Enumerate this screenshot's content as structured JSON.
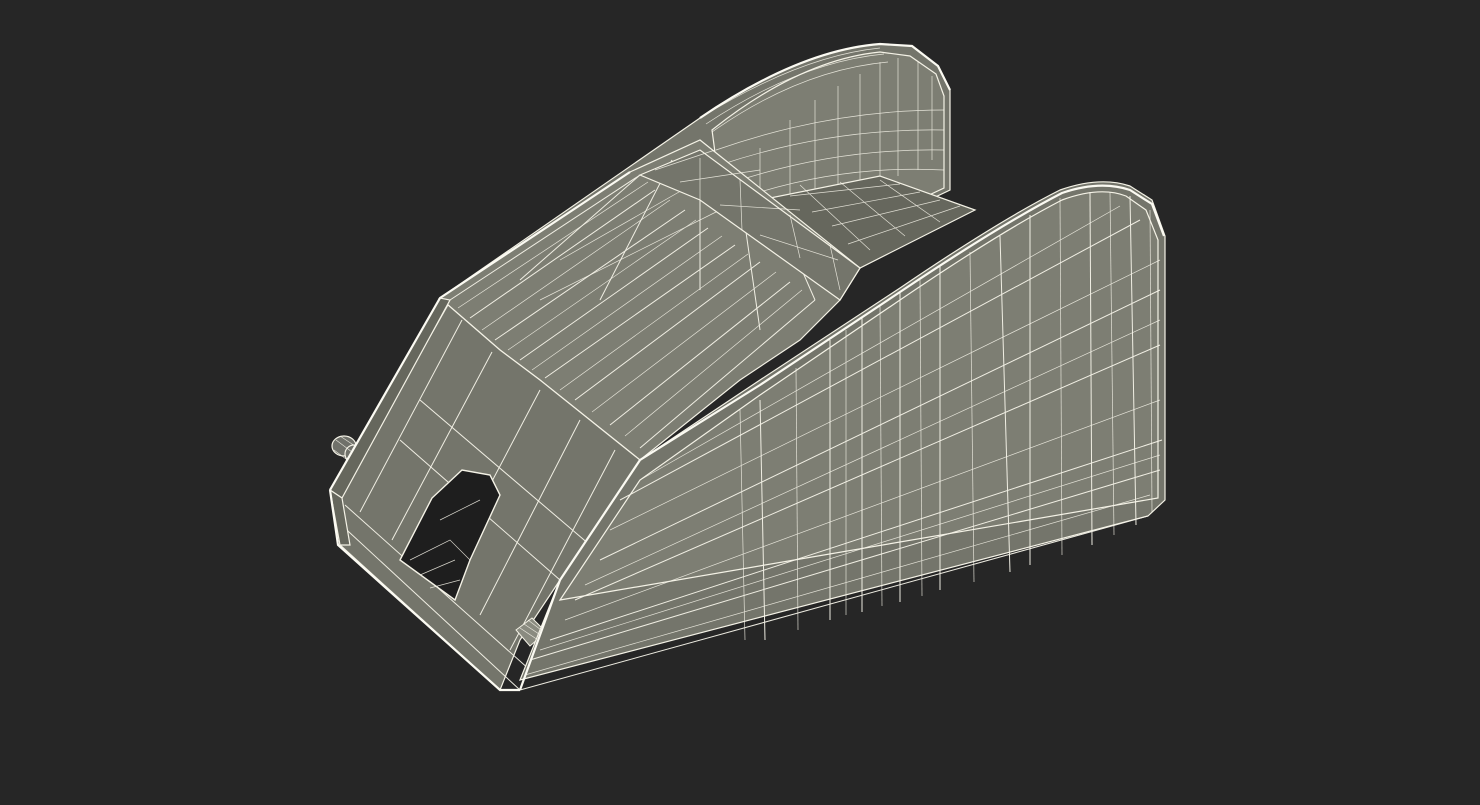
{
  "scene": {
    "background_color": "#262626",
    "model_fill_color": "#7a7b70",
    "wireframe_color": "#f4f2e6"
  }
}
